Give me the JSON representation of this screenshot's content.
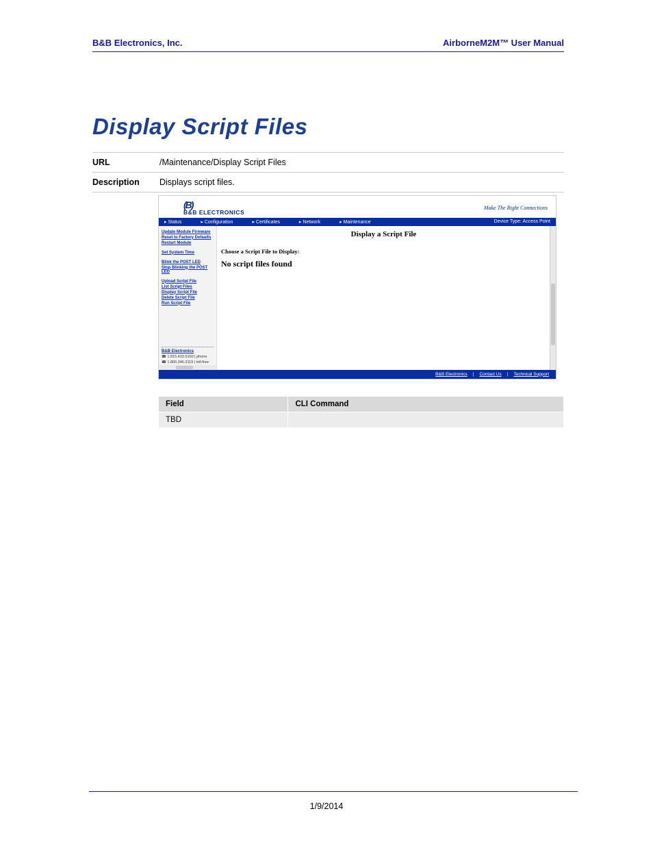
{
  "header": {
    "left": "B&B Electronics, Inc.",
    "right": "AirborneM2M™ User Manual"
  },
  "title": "Display Script Files",
  "info": {
    "url_label": "URL",
    "url_value": "/Maintenance/Display Script Files",
    "desc_label": "Description",
    "desc_value": "Displays script files."
  },
  "screenshot": {
    "logo_line1": "B",
    "logo_line2": "B&B ELECTRONICS",
    "tagline": "Make The Right Connections",
    "nav": {
      "status": "Status",
      "config": "Configuration",
      "certs": "Certificates",
      "network": "Network",
      "maint": "Maintenance",
      "device": "Device Type: Access Point"
    },
    "sidebar": {
      "g1a": "Update Module Firmware",
      "g1b": "Reset to Factory Defaults",
      "g1c": "Restart Module",
      "g2a": "Set System Time",
      "g3a": "Blink the POST LED",
      "g3b": "Stop Blinking the POST LED",
      "g4a": "Upload Script File",
      "g4b": "List Script Files",
      "g4c": "Display Script File",
      "g4d": "Delete Script File",
      "g4e": "Run Script File",
      "contact_name": "B&B Electronics",
      "phone1": "1.815.433.5100 | phone",
      "phone2": "1.800.346.3119 | toll-free"
    },
    "main": {
      "title": "Display a Script File",
      "choose": "Choose a Script File to Display:",
      "result": "No script files found"
    },
    "footer": {
      "a": "B&B Electronics",
      "b": "Contact Us",
      "c": "Technical Support"
    }
  },
  "cli": {
    "h1": "Field",
    "h2": "CLI Command",
    "r1": "TBD"
  },
  "footer_date": "1/9/2014"
}
